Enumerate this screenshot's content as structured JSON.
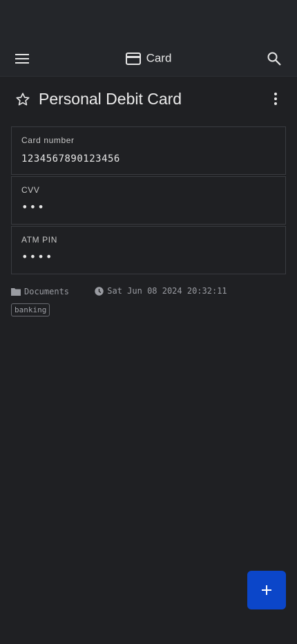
{
  "appbar": {
    "title": "Card",
    "icons": {
      "menu": "menu-icon",
      "type": "credit-card-icon",
      "search": "search-icon"
    }
  },
  "note": {
    "title": "Personal Debit Card",
    "favorite": false,
    "fields": [
      {
        "label": "Card number",
        "value": "1234567890123456"
      },
      {
        "label": "CVV",
        "value": "•••"
      },
      {
        "label": "ATM PIN",
        "value": "••••"
      }
    ],
    "folder": "Documents",
    "modified": "Sat Jun 08 2024 20:32:11",
    "tags": [
      "banking"
    ]
  },
  "fab": {
    "icon": "plus-icon"
  },
  "colors": {
    "background": "#1f2023",
    "appbar": "#24262a",
    "accent": "#0b46c9"
  }
}
